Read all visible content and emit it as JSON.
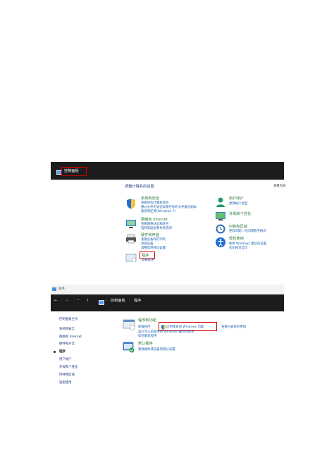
{
  "shot1": {
    "titlebar": {
      "title": "控制面板"
    },
    "heading": "调整计算机的设置",
    "view_by": "查看方式",
    "left": [
      {
        "title": "系统和安全",
        "links": [
          "查看你的计算机状态",
          "通过文件历史记录保存你的文件备份副本",
          "备份和还原(Windows 7)"
        ]
      },
      {
        "title": "网络和 Internet",
        "links": [
          "查看网络状态和任务",
          "选择家庭组和共享选项"
        ]
      },
      {
        "title": "硬件和声音",
        "links": [
          "查看设备和打印机",
          "添加设备",
          "调整常用移动设置"
        ]
      },
      {
        "title": "程序",
        "links": [
          "卸载程序"
        ]
      }
    ],
    "right": [
      {
        "title": "用户帐户",
        "links": [
          "更改帐户类型"
        ]
      },
      {
        "title": "外观和个性化",
        "links": []
      },
      {
        "title": "时钟和区域",
        "links": [
          "更改日期、时间或数字格式"
        ]
      },
      {
        "title": "轻松使用",
        "links": [
          "使用 Windows 建议的设置",
          "优化视觉显示"
        ]
      }
    ]
  },
  "shot2": {
    "titlebar": {
      "title": "程序"
    },
    "nav": {
      "back": "←",
      "forward": "→",
      "dropdown": "⌄",
      "up": "↑"
    },
    "breadcrumb": [
      "控制面板",
      "程序"
    ],
    "breadcrumb_sep": "›",
    "sidebar": {
      "home": "控制面板主页",
      "items": [
        "系统和安全",
        "网络和 Internet",
        "硬件和声音",
        "程序",
        "用户帐户",
        "外观和个性化",
        "时钟和区域",
        "轻松使用"
      ],
      "active_index": 3
    },
    "programs": {
      "title": "程序和功能",
      "links": [
        "卸载程序",
        "启用或关闭 Windows 功能",
        "查看已安装的更新"
      ],
      "link2": "运行为以前版本的 Windows 编写的程序",
      "link3": "如何安装程序"
    },
    "defaults": {
      "title": "默认程序",
      "link1": "更改媒体或设备的默认设置"
    }
  },
  "colors": {
    "titlebar": "#1c1c1c",
    "highlight": "#d40000",
    "link": "#1a5fb4"
  }
}
